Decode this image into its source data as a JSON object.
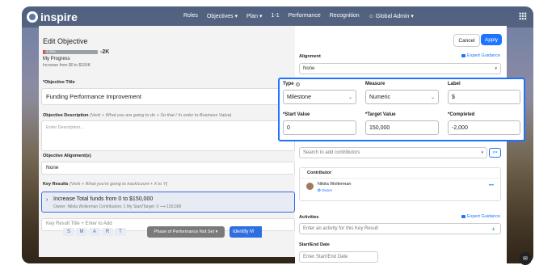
{
  "app": {
    "logo": "inspire"
  },
  "nav": {
    "items": [
      "Roles",
      "Objectives ▾",
      "Plan ▾",
      "1-1",
      "Performance",
      "Recognition",
      "☺ Global Admin ▾"
    ]
  },
  "left": {
    "title": "Edit Objective",
    "progress": {
      "bar_label": "-1.33%",
      "value": "-2K",
      "label": "My Progress",
      "increase": "Increase from $0 to $150K",
      "fill_fraction": 0.04
    },
    "objective_title_label": "*Objective Title",
    "objective_title_value": "Funding Performance Improvement",
    "description_label": "Objective Description",
    "description_hint": "(Verb + What you are going to do + So that / In order to Business Value)",
    "description_placeholder": "Enter Description...",
    "alignment_label": "Objective Alignment(s)",
    "alignment_value": "None",
    "kr_label": "Key Results",
    "kr_hint": "(Verb + What you're going to track/count + X to Y)",
    "kr_title": "Increase Total funds from 0 to $150,000",
    "kr_sub": "Owner: Nikita Wollerman   Contributors: 1   My Start/Target: 0 ⟶ 150,000",
    "kr_add_placeholder": "Key Result Title + Enter to Add",
    "smart": [
      "S",
      "M",
      "A",
      "R",
      "T"
    ],
    "phase_button": "Phase of Performance Not Set ▾",
    "identify_button": "Identify M"
  },
  "right": {
    "cancel": "Cancel",
    "apply": "Apply",
    "alignment_label": "Alignment",
    "expert_guidance": "Expert Guidance",
    "alignment_value": "None",
    "contributor_search_placeholder": "Search to add contributors",
    "contributor_header": "Contributor",
    "contributor_name": "Nikita Wollerman",
    "contributor_role": "✪ Owner",
    "activities_label": "Activities",
    "activity_placeholder": "Enter an activity for this Key Result",
    "dates_label": "Start/End Date",
    "dates_placeholder": "Enter Start/End Date"
  },
  "popup": {
    "type_label": "Type",
    "type_value": "Milestone",
    "measure_label": "Measure",
    "measure_value": "Numeric",
    "label_label": "Label",
    "label_value": "$",
    "start_label": "*Start Value",
    "start_value": "0",
    "target_label": "*Target Value",
    "target_value": "150,000",
    "completed_label": "*Completed",
    "completed_value": "-2,000"
  },
  "colors": {
    "accent": "#1e73ff",
    "progress_negative": "#d9534f",
    "owner_link": "#1e73ff"
  }
}
